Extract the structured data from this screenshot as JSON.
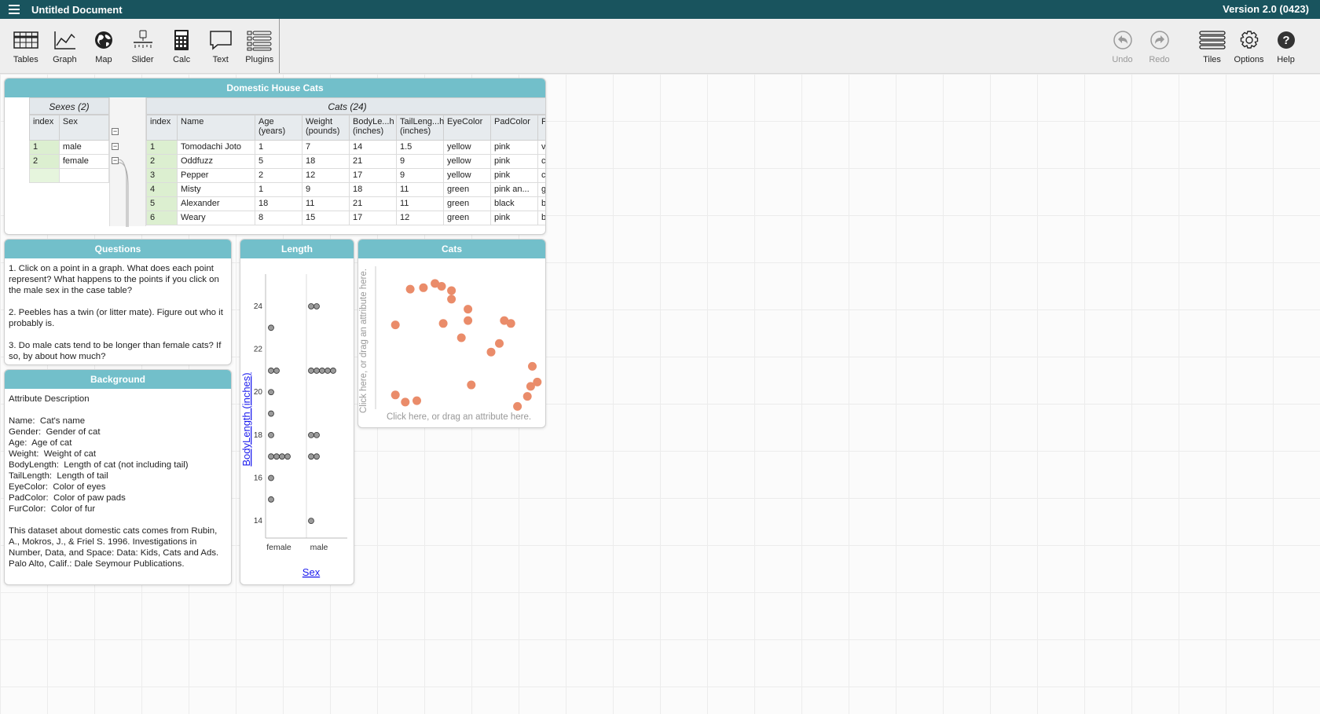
{
  "app": {
    "title": "Untitled Document",
    "version": "Version 2.0 (0423)"
  },
  "toolbar": {
    "left": [
      {
        "id": "tables",
        "label": "Tables"
      },
      {
        "id": "graph",
        "label": "Graph"
      },
      {
        "id": "map",
        "label": "Map"
      },
      {
        "id": "slider",
        "label": "Slider"
      },
      {
        "id": "calc",
        "label": "Calc"
      },
      {
        "id": "text",
        "label": "Text"
      },
      {
        "id": "plugins",
        "label": "Plugins"
      }
    ],
    "right": [
      {
        "id": "undo",
        "label": "Undo"
      },
      {
        "id": "redo",
        "label": "Redo"
      },
      {
        "id": "tiles",
        "label": "Tiles"
      },
      {
        "id": "options",
        "label": "Options"
      },
      {
        "id": "help",
        "label": "Help"
      }
    ]
  },
  "table": {
    "title": "Domestic House Cats",
    "parent": {
      "name": "Sexes (2)",
      "columns": [
        "index",
        "Sex"
      ],
      "rows": [
        [
          "1",
          "male"
        ],
        [
          "2",
          "female"
        ]
      ]
    },
    "child": {
      "name": "Cats (24)",
      "columns": [
        "index",
        "Name",
        "Age (years)",
        "Weight (pounds)",
        "BodyLe...h (inches)",
        "TailLeng...h (inches)",
        "EyeColor",
        "PadColor",
        "F"
      ],
      "rows": [
        [
          "1",
          "Tomodachi Joto",
          "1",
          "7",
          "14",
          "1.5",
          "yellow",
          "pink",
          "v"
        ],
        [
          "2",
          "Oddfuzz",
          "5",
          "18",
          "21",
          "9",
          "yellow",
          "pink",
          "c"
        ],
        [
          "3",
          "Pepper",
          "2",
          "12",
          "17",
          "9",
          "yellow",
          "pink",
          "c"
        ],
        [
          "4",
          "Misty",
          "1",
          "9",
          "18",
          "11",
          "green",
          "pink an...",
          "g"
        ],
        [
          "5",
          "Alexander",
          "18",
          "11",
          "21",
          "11",
          "green",
          "black",
          "b"
        ],
        [
          "6",
          "Weary",
          "8",
          "15",
          "17",
          "12",
          "green",
          "pink",
          "b"
        ]
      ]
    }
  },
  "questions": {
    "title": "Questions",
    "text": "1. Click on a point in a graph. What does each point represent? What happens to the points if you click on the male sex in the case table?\n\n2. Peebles has a twin (or litter mate). Figure out who it probably is.\n\n3. Do male cats tend to be longer than female cats? If so, by about how much?"
  },
  "background": {
    "title": "Background",
    "text": "Attribute Description\n\nName:  Cat's name\nGender:  Gender of cat\nAge:  Age of cat\nWeight:  Weight of cat\nBodyLength:  Length of cat (not including tail)\nTailLength:  Length of tail\nEyeColor:  Color of eyes\nPadColor:  Color of paw pads\nFurColor:  Color of fur\n\nThis dataset about domestic cats comes from Rubin, A., Mokros, J., & Friel S. 1996. Investigations in Number, Data, and Space: Data: Kids, Cats and Ads. Palo Alto, Calif.: Dale Seymour Publications."
  },
  "length_graph": {
    "title": "Length",
    "ylabel": "BodyLength (inches)",
    "xlabel": "Sex"
  },
  "cats_graph": {
    "title": "Cats",
    "x_hint": "Click here, or drag an attribute here.",
    "y_hint": "Click here, or drag an attribute here."
  },
  "chart_data": [
    {
      "type": "scatter",
      "title": "Length",
      "xlabel": "Sex",
      "ylabel": "BodyLength (inches)",
      "categories": [
        "female",
        "male"
      ],
      "ylim": [
        13.2,
        25.5
      ],
      "yticks": [
        14,
        16,
        18,
        20,
        22,
        24
      ],
      "series": [
        {
          "name": "female",
          "values": [
            23,
            21,
            21,
            20,
            19,
            18,
            17,
            17,
            17,
            17,
            16,
            15
          ]
        },
        {
          "name": "male",
          "values": [
            24,
            24,
            21,
            21,
            21,
            21,
            21,
            18,
            18,
            17,
            17,
            14
          ]
        }
      ]
    },
    {
      "type": "scatter",
      "title": "Cats",
      "color": "#ea8c6a",
      "x": [
        0.12,
        0.18,
        0.21,
        0.29,
        0.36,
        0.4,
        0.46,
        0.52,
        0.56,
        0.58,
        0.7,
        0.75,
        0.78,
        0.82,
        0.12,
        0.25,
        0.46,
        0.41,
        0.56,
        0.95,
        0.94,
        0.98,
        0.92,
        0.86
      ],
      "y": [
        0.1,
        0.05,
        0.84,
        0.85,
        0.88,
        0.86,
        0.77,
        0.5,
        0.7,
        0.17,
        0.4,
        0.46,
        0.62,
        0.6,
        0.59,
        0.06,
        0.83,
        0.6,
        0.62,
        0.3,
        0.16,
        0.19,
        0.09,
        0.02
      ]
    }
  ]
}
